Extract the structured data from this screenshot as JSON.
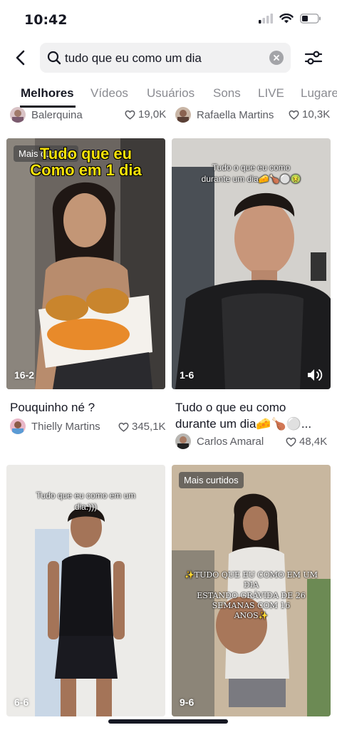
{
  "status": {
    "time": "10:42"
  },
  "search": {
    "query": "tudo que eu como um dia"
  },
  "tabs": [
    "Melhores",
    "Vídeos",
    "Usuários",
    "Sons",
    "LIVE",
    "Lugares"
  ],
  "top_row": [
    {
      "author": "Balerquina",
      "likes": "19,0K"
    },
    {
      "author": "Rafaella Martins",
      "likes": "10,3K"
    }
  ],
  "videos": [
    {
      "badge": "Mais curtidos",
      "overlay": "Tudo que eu\nComo em 1 dia",
      "count": "16-2",
      "caption": "Pouquinho né ?",
      "author": "Thielly Martins",
      "likes": "345,1K"
    },
    {
      "overlay": "Tudo o que eu como\ndurante um dia🧀🍗⚪🤢",
      "count": "1-6",
      "caption": "Tudo o que eu como\ndurante um dia🧀🍗⚪...",
      "author": "Carlos Amaral",
      "likes": "48,4K"
    },
    {
      "overlay": "Tudo que eu como em um\ndia:)))",
      "count": "6-6"
    },
    {
      "badge": "Mais curtidos",
      "overlay": "✨TUDO QUE EU COMO EM UM DIA\nESTANDO GRÁVIDA DE 26 SEMANAS COM 16\nANOS✨",
      "count": "9-6"
    }
  ],
  "colors": {
    "text": "#161823",
    "muted": "#8a8b91",
    "overlay_yellow": "#f7e20a"
  }
}
